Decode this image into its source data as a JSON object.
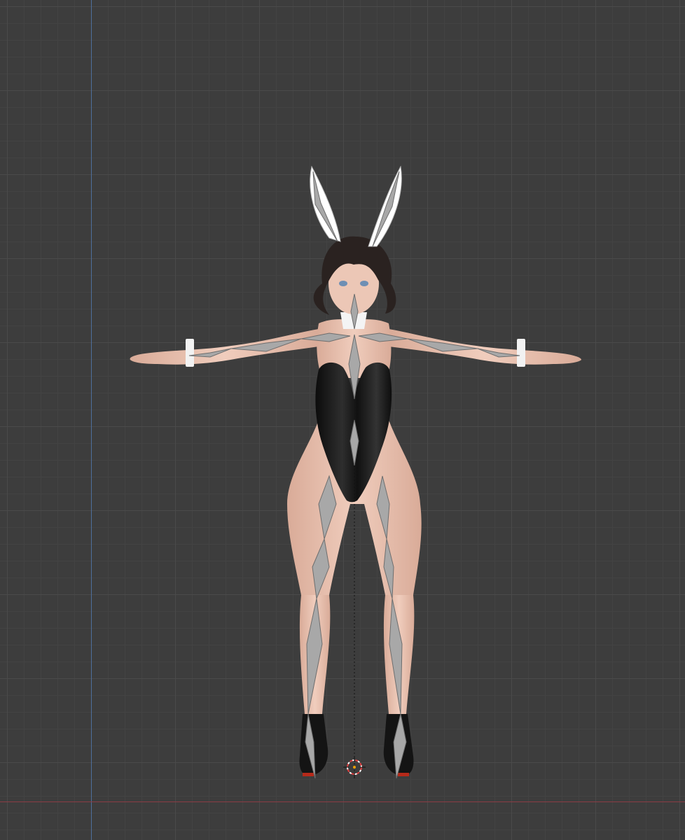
{
  "viewport": {
    "background": "#3d3d3d",
    "grid_major": "#4a4a4a",
    "grid_minor": "#434343",
    "y_axis_color": "#4f6f9c",
    "x_axis_color": "#8a3c44"
  },
  "scene": {
    "object": "character-model",
    "armature": "armature-overlay",
    "cursor_icon": "3d-cursor-icon",
    "colors": {
      "skin": "#e8c2b0",
      "skin_shadow": "#c99a88",
      "suit": "#151515",
      "suit_highlight": "#3a3a3a",
      "hair": "#2a2220",
      "bone": "#a8a8a8",
      "bone_outline": "#6e6e6e",
      "ear": "#ffffff",
      "heel_sole": "#b52a1a",
      "cursor_red": "#e04040"
    }
  }
}
